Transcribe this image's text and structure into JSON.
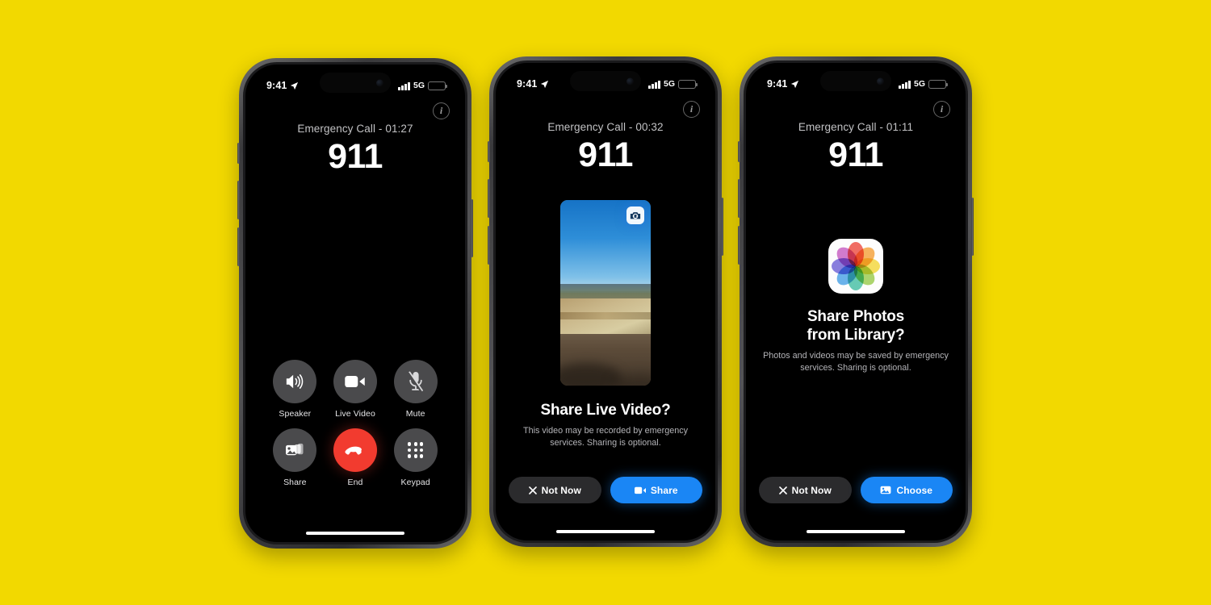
{
  "background_color": "#f2d900",
  "phones": [
    {
      "id": "phone-1",
      "screen": "call-controls",
      "status_bar": {
        "time": "9:41",
        "network": "5G",
        "location_icon": "location-arrow-icon",
        "signal_icon": "cellular-signal-icon",
        "battery_icon": "battery-icon"
      },
      "info_button": "i",
      "call": {
        "status": "Emergency Call - 01:27",
        "number": "911"
      },
      "controls": [
        {
          "label": "Speaker",
          "icon": "speaker-icon",
          "style": "neutral"
        },
        {
          "label": "Live Video",
          "icon": "video-camera-icon",
          "style": "neutral"
        },
        {
          "label": "Mute",
          "icon": "microphone-muted-icon",
          "style": "neutral"
        },
        {
          "label": "Share",
          "icon": "photos-stack-icon",
          "style": "neutral"
        },
        {
          "label": "End",
          "icon": "end-call-handset-icon",
          "style": "end"
        },
        {
          "label": "Keypad",
          "icon": "keypad-dots-icon",
          "style": "neutral"
        }
      ]
    },
    {
      "id": "phone-2",
      "screen": "share-live-video",
      "status_bar": {
        "time": "9:41",
        "network": "5G",
        "location_icon": "location-arrow-icon",
        "signal_icon": "cellular-signal-icon",
        "battery_icon": "battery-icon"
      },
      "info_button": "i",
      "call": {
        "status": "Emergency Call - 00:32",
        "number": "911"
      },
      "preview": {
        "type": "live-video-thumbnail",
        "flip_icon": "camera-flip-icon",
        "scene": "outdoor hillside with blue sky, distant hills, sandy slope and gravel foreground"
      },
      "sheet": {
        "title": "Share Live Video?",
        "subtitle": "This video may be recorded by emergency services. Sharing is optional."
      },
      "actions": [
        {
          "label": "Not Now",
          "icon": "close-x-icon",
          "style": "secondary"
        },
        {
          "label": "Share",
          "icon": "video-camera-icon",
          "style": "primary"
        }
      ]
    },
    {
      "id": "phone-3",
      "screen": "share-photos-library",
      "status_bar": {
        "time": "9:41",
        "network": "5G",
        "location_icon": "location-arrow-icon",
        "signal_icon": "cellular-signal-icon",
        "battery_icon": "battery-icon"
      },
      "info_button": "i",
      "call": {
        "status": "Emergency Call - 01:11",
        "number": "911"
      },
      "app_icon": "photos-app-icon",
      "sheet": {
        "title_line_1": "Share Photos",
        "title_line_2": "from Library?",
        "subtitle": "Photos and videos may be saved by emergency services. Sharing is optional."
      },
      "actions": [
        {
          "label": "Not Now",
          "icon": "close-x-icon",
          "style": "secondary"
        },
        {
          "label": "Choose",
          "icon": "photo-picker-icon",
          "style": "primary"
        }
      ]
    }
  ],
  "colors": {
    "end_call_red": "#f23b2f",
    "primary_blue": "#1a86f5",
    "control_gray": "#4a4a4c",
    "secondary_gray": "#2b2b2d"
  },
  "photos_icon_petals": [
    "#f04e43",
    "#f7a33c",
    "#f5d93c",
    "#9ccd4e",
    "#46c1a6",
    "#4aa3e8",
    "#6f63d8",
    "#c95fc4"
  ]
}
